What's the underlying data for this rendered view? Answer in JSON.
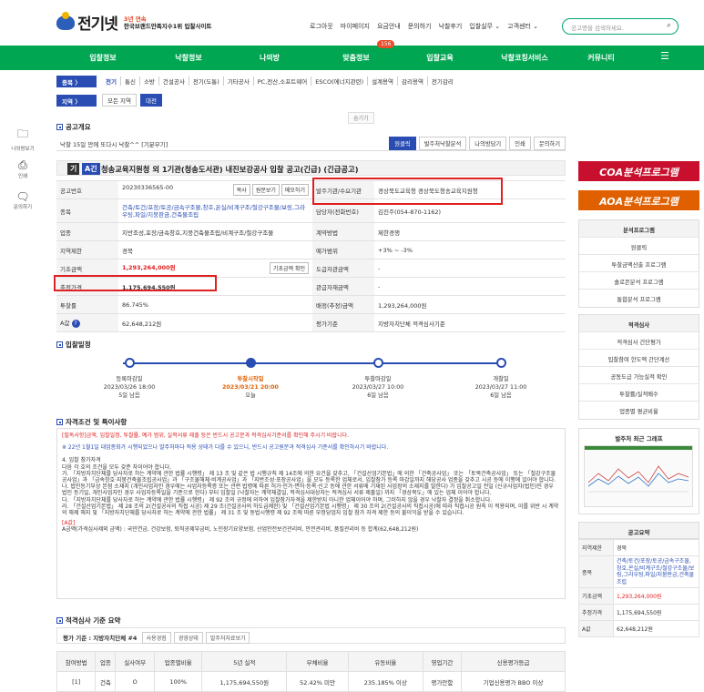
{
  "logo": {
    "text": "전기넷",
    "sub1": "3년 연속",
    "sub2": "한국브랜드만족지수1위 입찰사이트"
  },
  "toplinks": [
    "로그아웃",
    "마이페이지",
    "요금안내",
    "문의하기",
    "낙찰후기",
    "입찰실무 ⌄",
    "고객센터 ⌄"
  ],
  "search": {
    "placeholder": "공고명을 검색하세요."
  },
  "nav": {
    "items": [
      "입찰정보",
      "낙찰정보",
      "나의방",
      "맞춤정보",
      "입찰교육",
      "낙찰코칭서비스",
      "커뮤니티"
    ],
    "badge": "156"
  },
  "category": {
    "label": "종목  〉",
    "items": [
      "전기",
      "통신",
      "소방",
      "건설공사",
      "전기(도통)",
      "기타공사",
      "PC,전산,소프트웨어",
      "ESCO(에너지관련)",
      "설계용역",
      "감리용역",
      "전기감리"
    ]
  },
  "region": {
    "label": "지역  〉",
    "items": [
      "모든 지역",
      "대전"
    ]
  },
  "leftbar": {
    "items": [
      "나의방보기",
      "인쇄",
      "문의하기"
    ]
  },
  "folder_label": "숨기기",
  "section1": {
    "title": "공고개요"
  },
  "notice_bar": {
    "text": "낙찰 15일 만에 또다시 낙찰^^ [기분부기]",
    "buttons": [
      "원클릭",
      "발주처낙찰분석",
      "나의방담기",
      "인쇄",
      "문의하기"
    ]
  },
  "title": {
    "tag1": "기",
    "tag2": "A긴",
    "text": "청송교육지원청 외 1기관(청송도서관) 내진보강공사 입찰 공고(긴급) (긴급공고)"
  },
  "info": {
    "r1k": "공고번호",
    "r1v": "20230336565-00",
    "r1b": [
      "복사",
      "원문보기",
      "메모하기"
    ],
    "r1k2": "발주기관/수요기관",
    "r1v2": "경상북도교육청 경상북도청송교육지원청",
    "r2k": "종목",
    "r2v": "건축/토건/포장/토공/금속구조물,창호,온실/비계구조/철강구조물/보링,그라우팅,파일/지붕판금,건축물조립",
    "r2k2": "담당자(전화번호)",
    "r2v2": "김진주(054-870-1162)",
    "r3k": "업종",
    "r3v": "지반조성,포장/금속창호,지붕건축물조립/비계구조/철강구조물",
    "r3k2": "계약방법",
    "r3v2": "제한경쟁",
    "r4k": "지역제한",
    "r4v": "경북",
    "r4k2": "예가범위",
    "r4v2": "+3% ~ -3%",
    "r5k": "기초금액",
    "r5v": "1,293,264,000원",
    "r5b": "기초금액 확인",
    "r5k2": "도급자관금액",
    "r5v2": "-",
    "r6k": "추정가격",
    "r6v": "1,175,694,550원",
    "r6k2": "관급자재금액",
    "r6v2": "-",
    "r7k": "투찰률",
    "r7v": "86.745%",
    "r7k2": "배정(추정)금액",
    "r7v2": "1,293,264,000원",
    "r8k": "A값",
    "r8v": "62,648,212원",
    "r8k2": "평가기준",
    "r8v2": "지방자치단체 적격심사기준"
  },
  "section2": {
    "title": "입찰일정"
  },
  "timeline": [
    {
      "label": "등록마감일",
      "date": "2023/03/26 18:00",
      "rel": "5일 남음"
    },
    {
      "label": "투찰시작일",
      "date": "2023/03/21 20:00",
      "rel": "오늘"
    },
    {
      "label": "투찰마감일",
      "date": "2023/03/27 10:00",
      "rel": "6일 남음"
    },
    {
      "label": "개찰일",
      "date": "2023/03/27 11:00",
      "rel": "6일 남음"
    }
  ],
  "section3": {
    "title": "자격조건 및 특이사항"
  },
  "notes": {
    "n1": "[필독사항]금액, 입찰일정, 투찰률, 예가 범위, 실적서류 제출 등은 반드시 공고문과 적격심사기준서를 확인해 주시기 바랍니다.",
    "n2": "※ 22년 1월1일 대업종화가 시행되었으나 발주처마다 적용 상태가 다를 수 있으니, 반드시 공고원문과 적격심사 기준서를 확인하시기 바랍니다.",
    "n3": "4. 입찰 참가자격",
    "n4": "다음 각 호의 조건을 모두 갖춘 자이어야 합니다.",
    "n5": "가. 「지방자치단체를 당사자로 하는 계약에 관한 법률 시행령」 제 13 조 및 같은 법 시행규칙 제 14조에 의한 요건을 갖추고, 「건설산업기본법」에 의한 「건축공사업」 또는 「토목건축공사업」 또는 「철강구조물공사업」과 「금속창호·지붕건축물조립공사업」과 「구조물해체·비계공사업」과 「지반조성·포장공사업」을 모두 등록한 업체로서, 입찰참가 등록 마감일까지 해당공사 업종을 갖추고 시공 등에 이행에 있어야 합니다.",
    "n6": "나. 법인등기부상 본점 소재지 (개인사업자인 경우에는 사업자등록증 또는 관련 법령에 따른 허가·인가·면허·등록·신고 등에 관한 서류에 기재된 사업장의 소재지를 말한다) 가 입찰공고일 전일 (신규사업자(법인)인 경우 법인 등기일, 개인사업자인 경우 사업자등록일을 기준으로 한다) 부터 입찰일 (낙찰자는 계약체결일, 적격심사대상자는 적격심사 서류 제출일) 까지 「경상북도」에 있는 업체 이어야 합니다.",
    "n7": "다. 「지방자치단체를 당사자로 하는 계약에 관한 법률 시행령」 제 92 조의 규정에 의하여 입찰참가자격을 제한받지 아니한 업체이어야 하며, 그러하지 않을 경우 낙찰자 결정을 취소합니다.",
    "n8": "라. 「건설산업기본법」 제 28 조의 2(건설공사의 직접 시공) 제 29 조(건설공사의 하도급제한) 및 「건설산업기본법 시행령」 제 30 조의 2(건설공사의 직접시공)에 따라 직접시공 원칙 이 적용되며, 이를 위반 시 계약의 해제 해지 및 「지방자치단체를 당사자로 하는 계약에 관한 법률」 제 31 조 및 동법시행령 제 92 조에 따른 부정당업자 입찰 참가 자격 제한 등의 불이익을 받을 수 있습니다.",
    "n9": "[A값]",
    "n10": "A금액(가격심사제외 금액) : 국민연금, 건강보험, 퇴직공제부금비, 노인장기요양보험, 산업안전보건관리비, 안전관리비, 품질관리비 등 합계(62,648,212원)"
  },
  "section4": {
    "title": "적격심사 기준 요약"
  },
  "eval": {
    "label": "평가 기준 : 지방자치단체 #4",
    "buttons": [
      "사용경험",
      "경영상태",
      "발주처자료보기"
    ]
  },
  "bottom_table": {
    "headers": [
      "참여방법",
      "업종",
      "실사여부",
      "업종별비율",
      "5년 실적",
      "부채비율",
      "유동비율",
      "영업기간",
      "신용평가등급"
    ],
    "row": [
      "[1]",
      "건축",
      "O",
      "100%",
      "1,175,694,550원",
      "52.42% 미만",
      "235.185% 이상",
      "평가안함",
      "기업신용평가 BBO 이상"
    ]
  },
  "sidebar": {
    "banner1": "COA분석프로그램",
    "banner2": "AOA분석프로그램",
    "group1": [
      "분석프로그램",
      "원클릭",
      "투찰금액산출 프로그램",
      "솔로몬분석 프로그램",
      "통합분석 프로그램"
    ],
    "group2": [
      "적격심사",
      "적격심사 간단평가",
      "입찰참여 한도액 간단계산",
      "공동도급 가능실적 확인",
      "투찰률/실적배수",
      "업종별 평균비율"
    ],
    "chart_title": "발주처 최근 그래프",
    "summary_title": "공고요약",
    "summary": [
      {
        "k": "지역제한",
        "v": "경북"
      },
      {
        "k": "종목",
        "v": "건축/토건/포장/토공/금속구조물,창호,온실/비계구조/철강구조물/보링,그라우팅,파일/지붕판금,건축물조립"
      },
      {
        "k": "기초금액",
        "v": "1,293,264,000원"
      },
      {
        "k": "추정가격",
        "v": "1,175,694,550원"
      },
      {
        "k": "A값",
        "v": "62,648,212원"
      }
    ]
  },
  "colors": {
    "nav": "#00a651",
    "accent": "#2a4db3",
    "alert": "#e02020",
    "coa": "#c8102e",
    "aoa": "#e06000"
  }
}
